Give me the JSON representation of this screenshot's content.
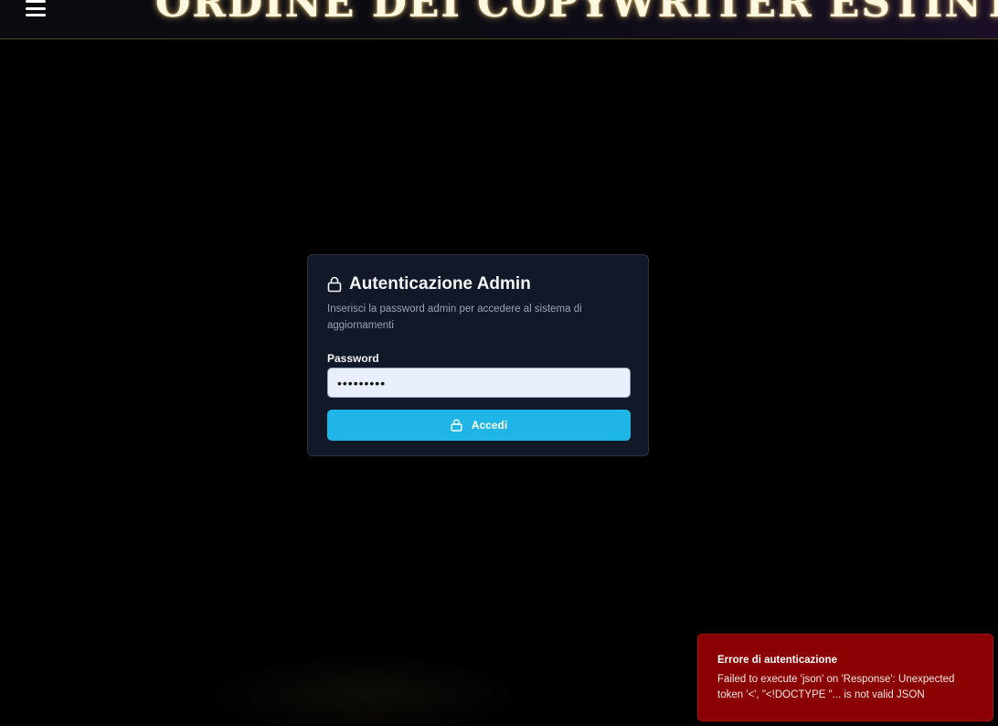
{
  "header": {
    "site_title": "ORDINE DEI COPYWRITER ESTINTI",
    "menu_icon": "hamburger-menu-icon"
  },
  "login_card": {
    "title": "Autenticazione Admin",
    "title_icon": "lock-icon",
    "description": "Inserisci la password admin per accedere al sistema di aggiornamenti",
    "password_label": "Password",
    "password_value": "•••••••••",
    "submit_label": "Accedi",
    "submit_icon": "lock-icon"
  },
  "toast": {
    "title": "Errore di autenticazione",
    "message": "Failed to execute 'json' on 'Response': Unexpected token '<', \"<!DOCTYPE \"... is not valid JSON"
  },
  "colors": {
    "background": "#000000",
    "card_bg": "#111827",
    "accent_button": "#1fb5e6",
    "toast_bg": "#8b0000",
    "title_glow": "#ffd88a"
  }
}
